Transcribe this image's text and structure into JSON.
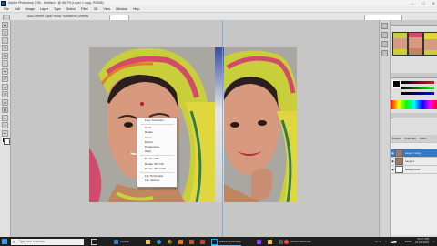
{
  "window": {
    "title": "Adobe Photoshop CS6 - Untitled-1 @ 66.7% (Layer 1 copy, RGB/8)",
    "min": "—",
    "max": "☐",
    "close": "✕"
  },
  "menubar": [
    "File",
    "Edit",
    "Image",
    "Layer",
    "Type",
    "Select",
    "Filter",
    "3D",
    "View",
    "Window",
    "Help"
  ],
  "optionsbar": {
    "text": "Auto-Select:  Layer   Show Transform Controls"
  },
  "context_menu": {
    "items": [
      "Free Transform",
      "Scale",
      "Rotate",
      "Skew",
      "Distort",
      "Perspective",
      "Warp",
      "Rotate 180°",
      "Rotate 90° CW",
      "Rotate 90° CCW",
      "Flip Horizontal",
      "Flip Vertical"
    ]
  },
  "layers_panel": {
    "tabs": [
      "Layers",
      "Channels",
      "Paths"
    ],
    "rows": [
      {
        "name": "Layer 1 copy",
        "active": true
      },
      {
        "name": "Layer 1",
        "active": false
      },
      {
        "name": "Background",
        "active": false
      }
    ]
  },
  "taskbar": {
    "search_placeholder": "Type here to search",
    "apps": [
      {
        "name": "Photos",
        "color": "#3a7bd5"
      },
      {
        "name": "Adobe Photoshop",
        "color": "#31a8ff"
      },
      {
        "name": "Screen Recorder",
        "color": "#e84c3d"
      }
    ],
    "temp": "27°C",
    "lang": "ENG",
    "time": "04:17 PM",
    "date": "24-04-2021"
  },
  "colors": {
    "accent": "#3478c6",
    "taskbar": "#1f1f1f"
  }
}
